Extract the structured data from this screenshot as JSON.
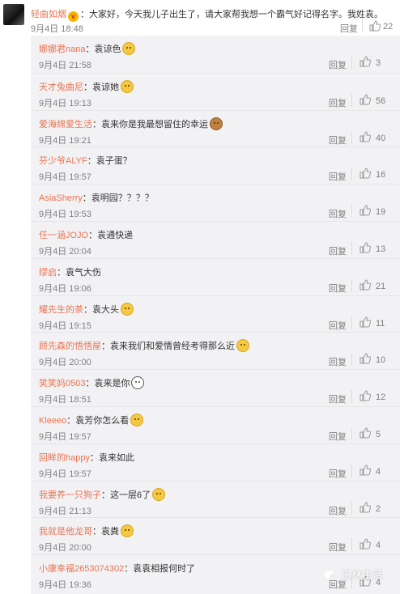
{
  "post": {
    "author": "轻曲如烟",
    "text": "：大家好，今天我儿子出生了，请大家帮我想一个霸气好记得名字。我姓袁。",
    "time": "9月4日 18:48",
    "reply_label": "回复",
    "like_count": "22"
  },
  "comments": [
    {
      "author": "娜娜君nana",
      "text": "：袁谅色",
      "emoji": "cat-emoji",
      "time": "9月4日 21:58",
      "reply_label": "回复",
      "likes": "3"
    },
    {
      "author": "天才兔曲尼",
      "text": "：袁谅她",
      "emoji": "cat-emoji",
      "time": "9月4日 19:13",
      "reply_label": "回复",
      "likes": "56"
    },
    {
      "author": "爱海绵爱生活",
      "text": "：袁来你是我最想留住的幸运",
      "emoji": "dog-emoji",
      "time": "9月4日 19:21",
      "reply_label": "回复",
      "likes": "40"
    },
    {
      "author": "芬少爷ALYF",
      "text": "：袁子蛋？",
      "emoji": "",
      "time": "9月4日 19:57",
      "reply_label": "回复",
      "likes": "16"
    },
    {
      "author": "AsiaSherry",
      "text": "：袁明园？？？？",
      "emoji": "",
      "time": "9月4日 19:53",
      "reply_label": "回复",
      "likes": "19"
    },
    {
      "author": "任一涵JOJO",
      "text": "：袁通快递",
      "emoji": "",
      "time": "9月4日 20:04",
      "reply_label": "回复",
      "likes": "13"
    },
    {
      "author": "缪启",
      "text": "：袁气大伤",
      "emoji": "",
      "time": "9月4日 19:06",
      "reply_label": "回复",
      "likes": "21"
    },
    {
      "author": "耀先生的茶",
      "text": "：袁大头",
      "emoji": "cat-emoji",
      "time": "9月4日 19:15",
      "reply_label": "回复",
      "likes": "11"
    },
    {
      "author": "顾先森的悟悟屋",
      "text": "：袁来我们和爱情曾经考得那么近",
      "emoji": "cat-emoji",
      "time": "9月4日 20:00",
      "reply_label": "回复",
      "likes": "10"
    },
    {
      "author": "笑笑妈0503",
      "text": "：袁来是你",
      "emoji": "face-emoji",
      "time": "9月4日 18:51",
      "reply_label": "回复",
      "likes": "12"
    },
    {
      "author": "Kleeeo",
      "text": "：袁芳你怎么看",
      "emoji": "cat-emoji",
      "time": "9月4日 19:57",
      "reply_label": "回复",
      "likes": "5"
    },
    {
      "author": "回眸的happy",
      "text": "：袁来如此",
      "emoji": "",
      "time": "9月4日 19:57",
      "reply_label": "回复",
      "likes": "4"
    },
    {
      "author": "我要养一只狗子",
      "text": "：这一层6了",
      "emoji": "cat-emoji",
      "time": "9月4日 21:13",
      "reply_label": "回复",
      "likes": "2"
    },
    {
      "author": "我就是他龙哥",
      "text": "：袁粪",
      "emoji": "cat-emoji",
      "time": "9月4日 20:00",
      "reply_label": "回复",
      "likes": "4"
    },
    {
      "author": "小康幸福2653074302",
      "text": "：袁袁相报何时了",
      "emoji": "",
      "time": "9月4日 19:36",
      "reply_label": "回复",
      "likes": "4"
    }
  ],
  "watermark": {
    "text": "王林生活"
  }
}
